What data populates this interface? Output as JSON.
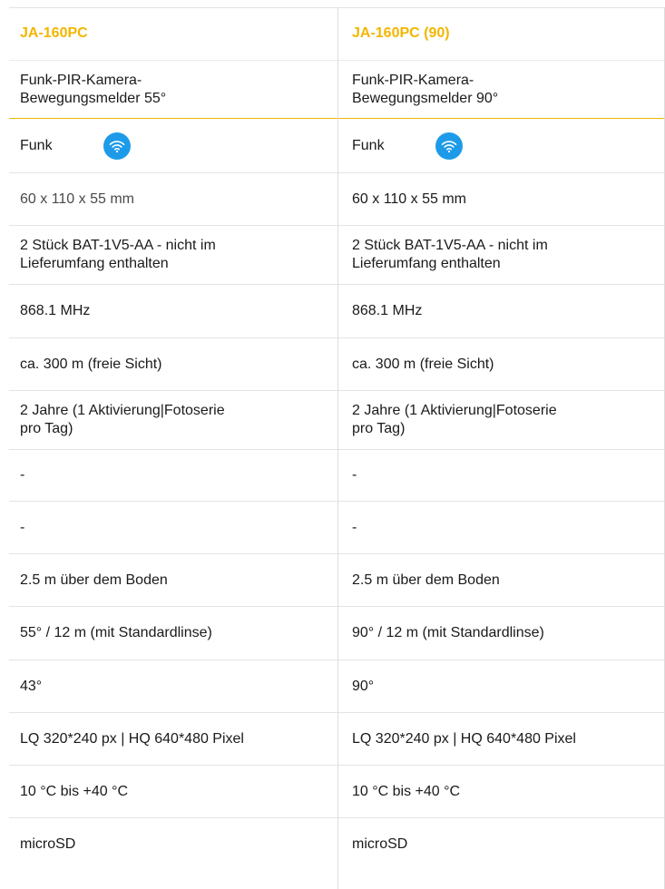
{
  "columns": [
    {
      "header": "JA-160PC",
      "type": "Funk-PIR-Kamera-\nBewegungsmelder 55°",
      "connection": "Funk",
      "dimensions": "60 x 110 x 55 mm",
      "battery": "2 Stück BAT-1V5-AA - nicht im\nLieferumfang enthalten",
      "frequency": "868.1 MHz",
      "range": "ca. 300 m (freie Sicht)",
      "battery_life": "2 Jahre (1 Aktivierung|Fotoserie\npro Tag)",
      "blank1": "-",
      "blank2": "-",
      "mounting": "2.5 m über dem Boden",
      "detection": "55° / 12 m (mit Standardlinse)",
      "camera_angle": "43°",
      "resolution": "LQ 320*240 px | HQ 640*480 Pixel",
      "temperature": "10 °C bis +40 °C",
      "storage": "microSD"
    },
    {
      "header": "JA-160PC (90)",
      "type": "Funk-PIR-Kamera-\nBewegungsmelder 90°",
      "connection": "Funk",
      "dimensions": "60 x 110 x 55 mm",
      "battery": "2 Stück BAT-1V5-AA - nicht im\nLieferumfang enthalten",
      "frequency": "868.1 MHz",
      "range": "ca. 300 m (freie Sicht)",
      "battery_life": "2 Jahre (1 Aktivierung|Fotoserie\npro Tag)",
      "blank1": "-",
      "blank2": "-",
      "mounting": "2.5 m über dem Boden",
      "detection": "90° / 12 m (mit Standardlinse)",
      "camera_angle": "90°",
      "resolution": "LQ 320*240 px | HQ 640*480 Pixel",
      "temperature": "10 °C bis +40 °C",
      "storage": "microSD"
    }
  ],
  "icons": {
    "connection_icon": "wifi-icon"
  },
  "colors": {
    "header": "#f2b600",
    "wifi_badge": "#1e9be8",
    "accent_line": "#f0b400"
  }
}
